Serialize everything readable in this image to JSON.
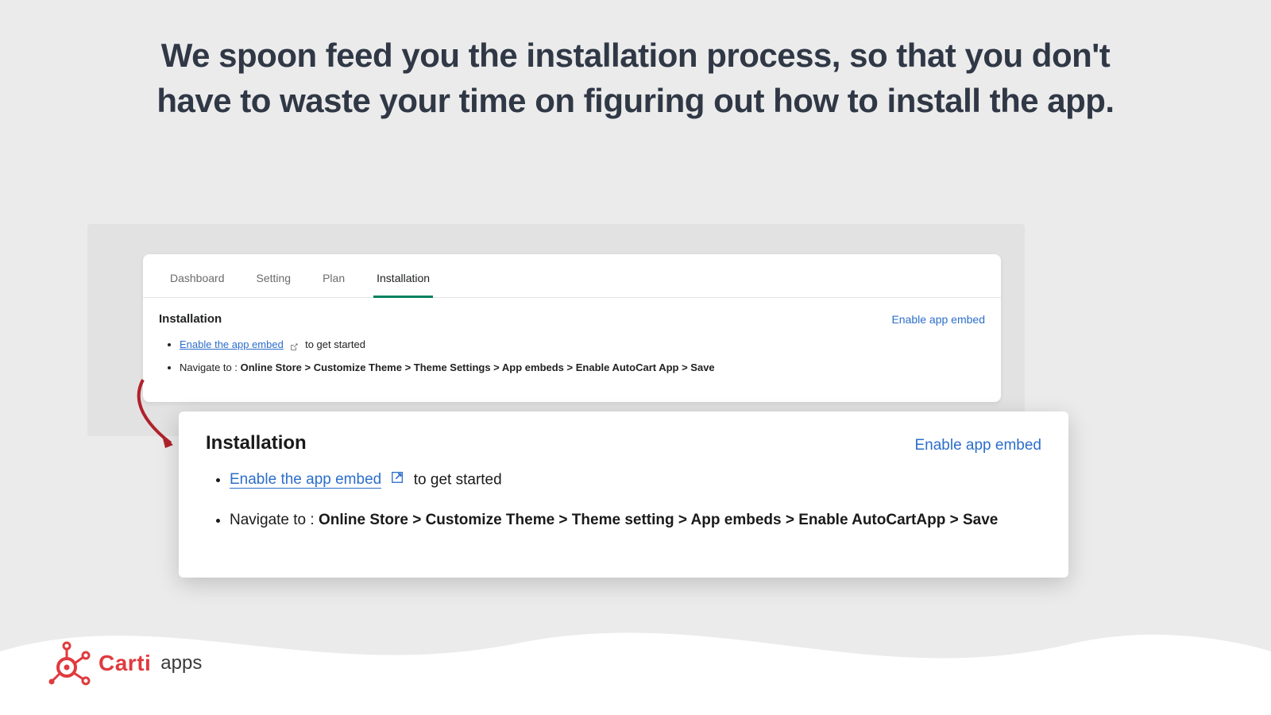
{
  "headline": "We spoon feed you the installation process, so that you don't have to waste your time on figuring out how to install the app.",
  "tabs": {
    "dashboard": "Dashboard",
    "setting": "Setting",
    "plan": "Plan",
    "installation": "Installation"
  },
  "card1": {
    "heading": "Installation",
    "enable_app_link": "Enable app embed",
    "bullet1_link": "Enable the app embed",
    "bullet1_suffix": "to get started",
    "bullet2_prefix": "Navigate to : ",
    "bullet2_bold": "Online Store > Customize Theme > Theme Settings > App embeds > Enable AutoCart App > Save"
  },
  "card2": {
    "heading": "Installation",
    "enable_app_link": "Enable app embed",
    "bullet1_link": "Enable the app embed",
    "bullet1_suffix": "to get started",
    "bullet2_prefix": "Navigate to : ",
    "bullet2_bold": "Online Store > Customize Theme > Theme setting > App embeds > Enable AutoCartApp > Save"
  },
  "logo": {
    "brand": "Carti",
    "suffix": "apps"
  }
}
